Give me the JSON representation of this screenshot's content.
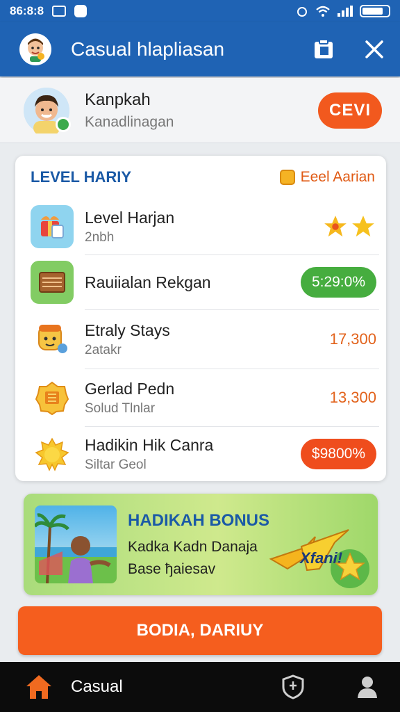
{
  "status_bar": {
    "time": "86:8:8",
    "icons": [
      "image-icon",
      "app-icon",
      "alarm-icon",
      "wifi-icon",
      "signal-icon",
      "battery-icon"
    ]
  },
  "app_bar": {
    "title": "Casual hlapliasan",
    "logo_icon": "mascot-logo-icon",
    "actions": [
      "clipboard-icon",
      "close-icon"
    ]
  },
  "profile": {
    "name": "Kanpkah",
    "subtitle": "Kanadlinagan",
    "button_label": "CEVI"
  },
  "level_card": {
    "title": "LEVEL HARIY",
    "right_label": "Eeel Aarian",
    "rows": [
      {
        "title": "Level Harjan",
        "subtitle": "2nbh",
        "icon": "gift-box-icon",
        "right_type": "stars",
        "stars": 2
      },
      {
        "title": "Rauiialan Rekgan",
        "subtitle": "",
        "icon": "wooden-crate-icon",
        "right_type": "pill-green",
        "right_value": "5:29:0%"
      },
      {
        "title": "Etraly Stays",
        "subtitle": "2atakr",
        "icon": "character-icon",
        "right_type": "value",
        "right_value": "17,300"
      },
      {
        "title": "Gerlad Pedn",
        "subtitle": "Solud Tlnlar",
        "icon": "badge-icon",
        "right_type": "value",
        "right_value": "13,300"
      },
      {
        "title": "Hadikin Hik Canra",
        "subtitle": "Siltar Geol",
        "icon": "sun-star-icon",
        "right_type": "pill-red",
        "right_value": "$9800%"
      }
    ]
  },
  "bonus": {
    "title": "HADIKAH BONUS",
    "line1": "Kadka Kadn Danaja",
    "line2": "Base ђaiesav",
    "art_text": "Xfani!"
  },
  "cta": {
    "label": "BODIA, DARIUY"
  },
  "nav": {
    "label": "Casual",
    "icons": [
      "home-icon",
      "shield-icon",
      "profile-icon"
    ]
  },
  "colors": {
    "primary": "#1f63b4",
    "accent": "#f2591e",
    "green": "#46ad3f",
    "value_orange": "#e2621b"
  }
}
